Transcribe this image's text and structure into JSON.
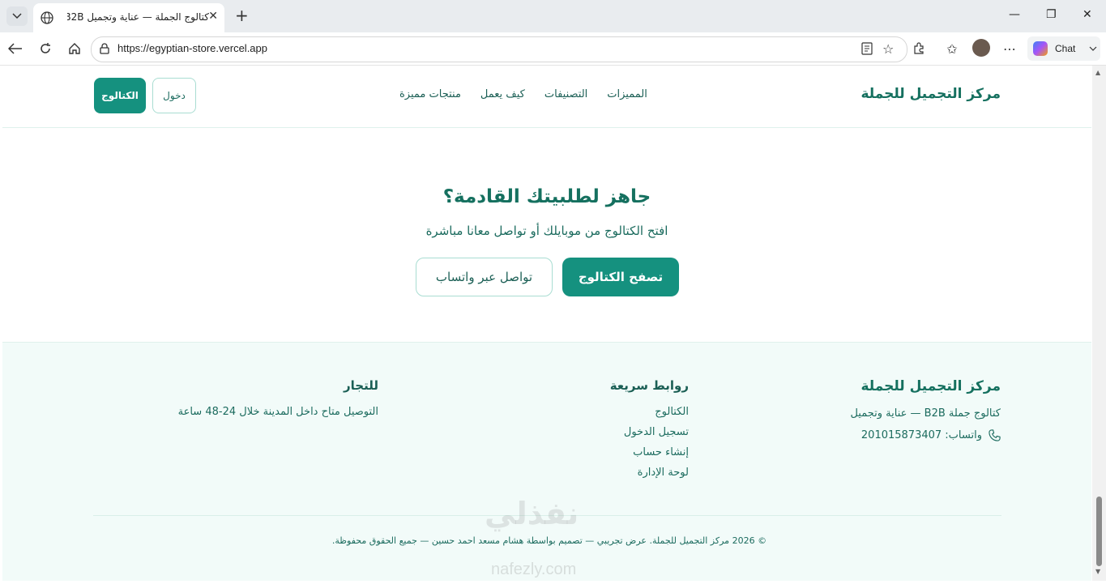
{
  "browser": {
    "tab_title": "كتالوج الجملة — عناية وتجميل B2B",
    "url": "https://egyptian-store.vercel.app",
    "chat_label": "Chat"
  },
  "header": {
    "brand": "مركز التجميل للجملة",
    "nav": [
      "المميزات",
      "التصنيفات",
      "كيف يعمل",
      "منتجات مميزة"
    ],
    "login_label": "دخول",
    "catalog_label": "الكتالوج"
  },
  "cta": {
    "heading": "جاهز لطلبيتك القادمة؟",
    "subtitle": "افتح الكتالوج من موبايلك أو تواصل معانا مباشرة",
    "primary_label": "تصفح الكتالوج",
    "secondary_label": "تواصل عبر واتساب"
  },
  "footer": {
    "brand": "مركز التجميل للجملة",
    "tagline": "كتالوج جملة B2B — عناية وتجميل",
    "whatsapp": "واتساب: 201015873407",
    "links_title": "روابط سريعة",
    "links": [
      "الكتالوج",
      "تسجيل الدخول",
      "إنشاء حساب",
      "لوحة الإدارة"
    ],
    "merchants_title": "للتجار",
    "merchants_text": "التوصيل متاح داخل المدينة خلال 24-48 ساعة",
    "copyright": "© 2026 مركز التجميل للجملة. عرض تجريبي — تصميم بواسطة هشام مسعد احمد حسين — جميع الحقوق محفوظة."
  },
  "watermark": {
    "arabic": "نفذلي",
    "latin": "nafezly.com"
  },
  "colors": {
    "primary": "#15917f",
    "text": "#1b5f55",
    "footer_bg": "#f2fbf9"
  }
}
